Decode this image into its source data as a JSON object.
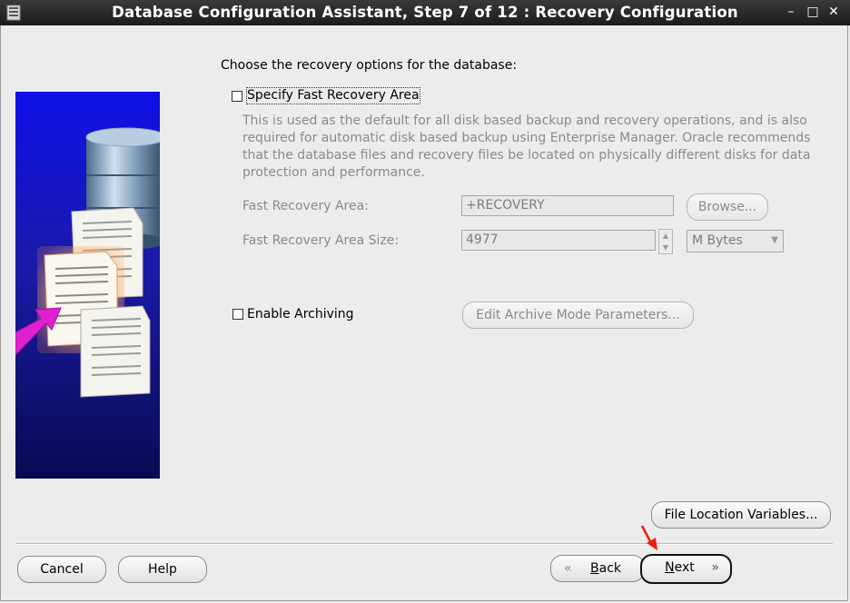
{
  "window": {
    "title": "Database Configuration Assistant, Step 7 of 12 : Recovery Configuration",
    "controls": [
      "minimize",
      "maximize",
      "close"
    ]
  },
  "intro_text": "Choose the recovery options for the database:",
  "fast_recovery": {
    "checkbox_label": "Specify Fast Recovery Area",
    "checked": false,
    "description": "This is used as the default for all disk based backup and recovery operations, and is also required for automatic disk based backup using Enterprise Manager. Oracle recommends that the database files and recovery files be located on physically different disks for data protection and performance.",
    "area_label": "Fast Recovery Area:",
    "area_value": "+RECOVERY",
    "browse_label": "Browse...",
    "size_label": "Fast Recovery Area Size:",
    "size_value": "4977",
    "size_unit": "M Bytes"
  },
  "archiving": {
    "checkbox_label": "Enable Archiving",
    "checked": false,
    "edit_button_label": "Edit Archive Mode Parameters..."
  },
  "file_location_button_label": "File Location Variables...",
  "footer": {
    "cancel_label": "Cancel",
    "help_label": "Help",
    "back_mnemonic": "B",
    "back_rest": "ack",
    "next_mnemonic": "N",
    "next_rest": "ext"
  },
  "colors": {
    "titlebar": "#2a2a2a",
    "background": "#ececec",
    "annotation_arrow": "#e8200c"
  }
}
